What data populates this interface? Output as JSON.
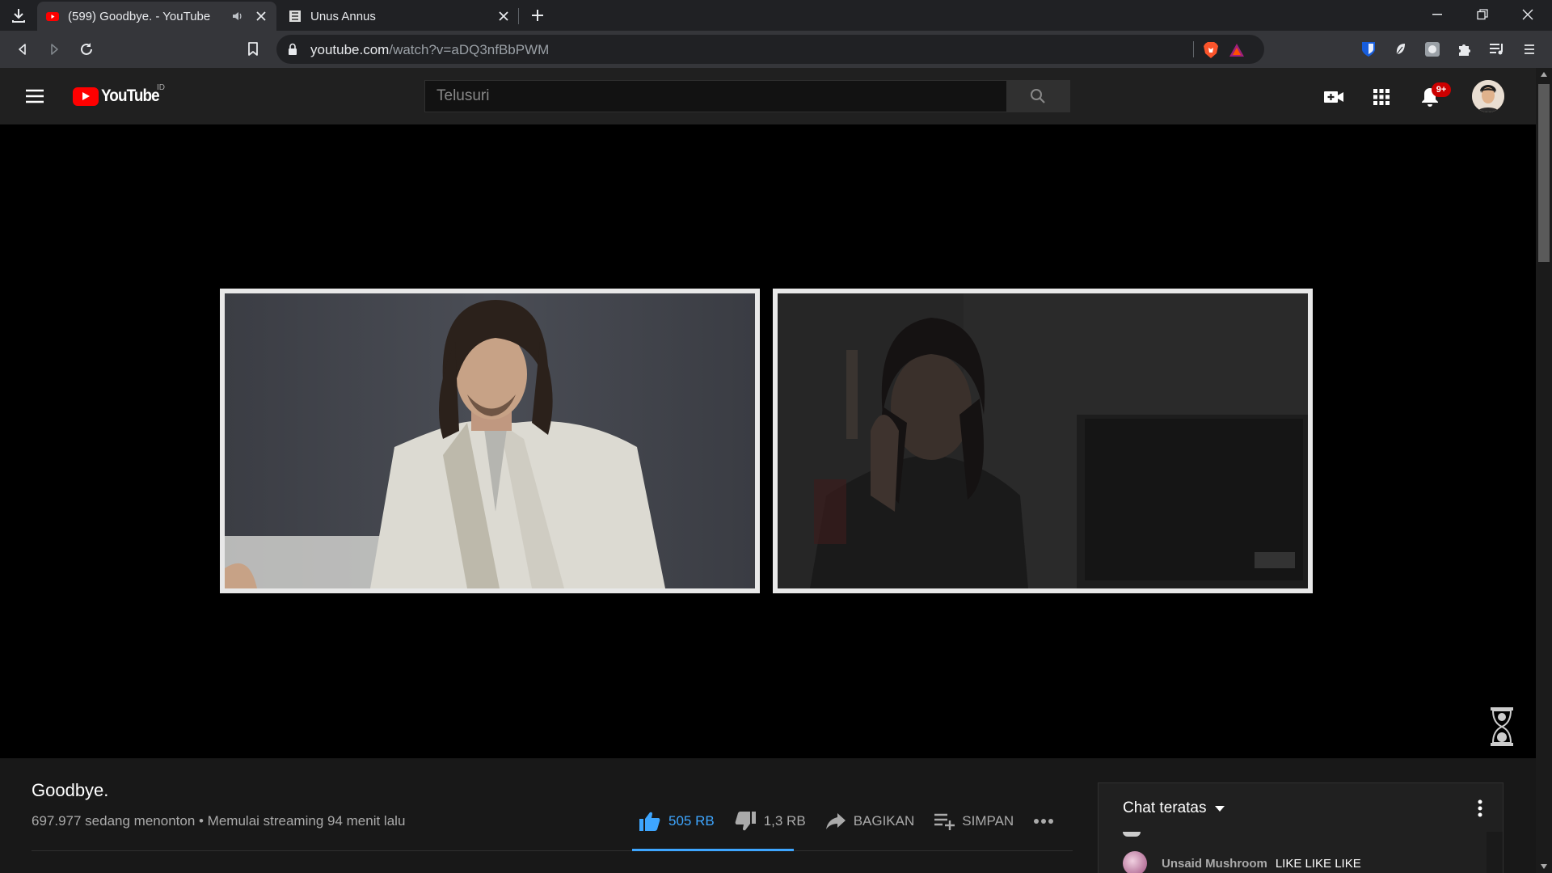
{
  "browser": {
    "tabs": [
      {
        "title": "(599) Goodbye. - YouTube",
        "active": true,
        "audible": true
      },
      {
        "title": "Unus Annus",
        "active": false,
        "audible": false
      }
    ],
    "url_host": "youtube.com",
    "url_path": "/watch?v=aDQ3nfBbPWM"
  },
  "youtube": {
    "logo_text": "YouTube",
    "region": "ID",
    "search_placeholder": "Telusuri",
    "notification_count": "9+"
  },
  "video": {
    "title": "Goodbye.",
    "meta": "697.977 sedang menonton • Memulai streaming 94 menit lalu",
    "likes": "505 RB",
    "dislikes": "1,3 RB",
    "share_label": "BAGIKAN",
    "save_label": "SIMPAN"
  },
  "chat": {
    "header": "Chat teratas",
    "messages": [
      {
        "author": "Unsaid Mushroom",
        "text": "LIKE LIKE LIKE"
      }
    ]
  },
  "colors": {
    "accent_like": "#3ea6ff",
    "brand_red": "#ff0000",
    "badge_red": "#cc0000"
  }
}
